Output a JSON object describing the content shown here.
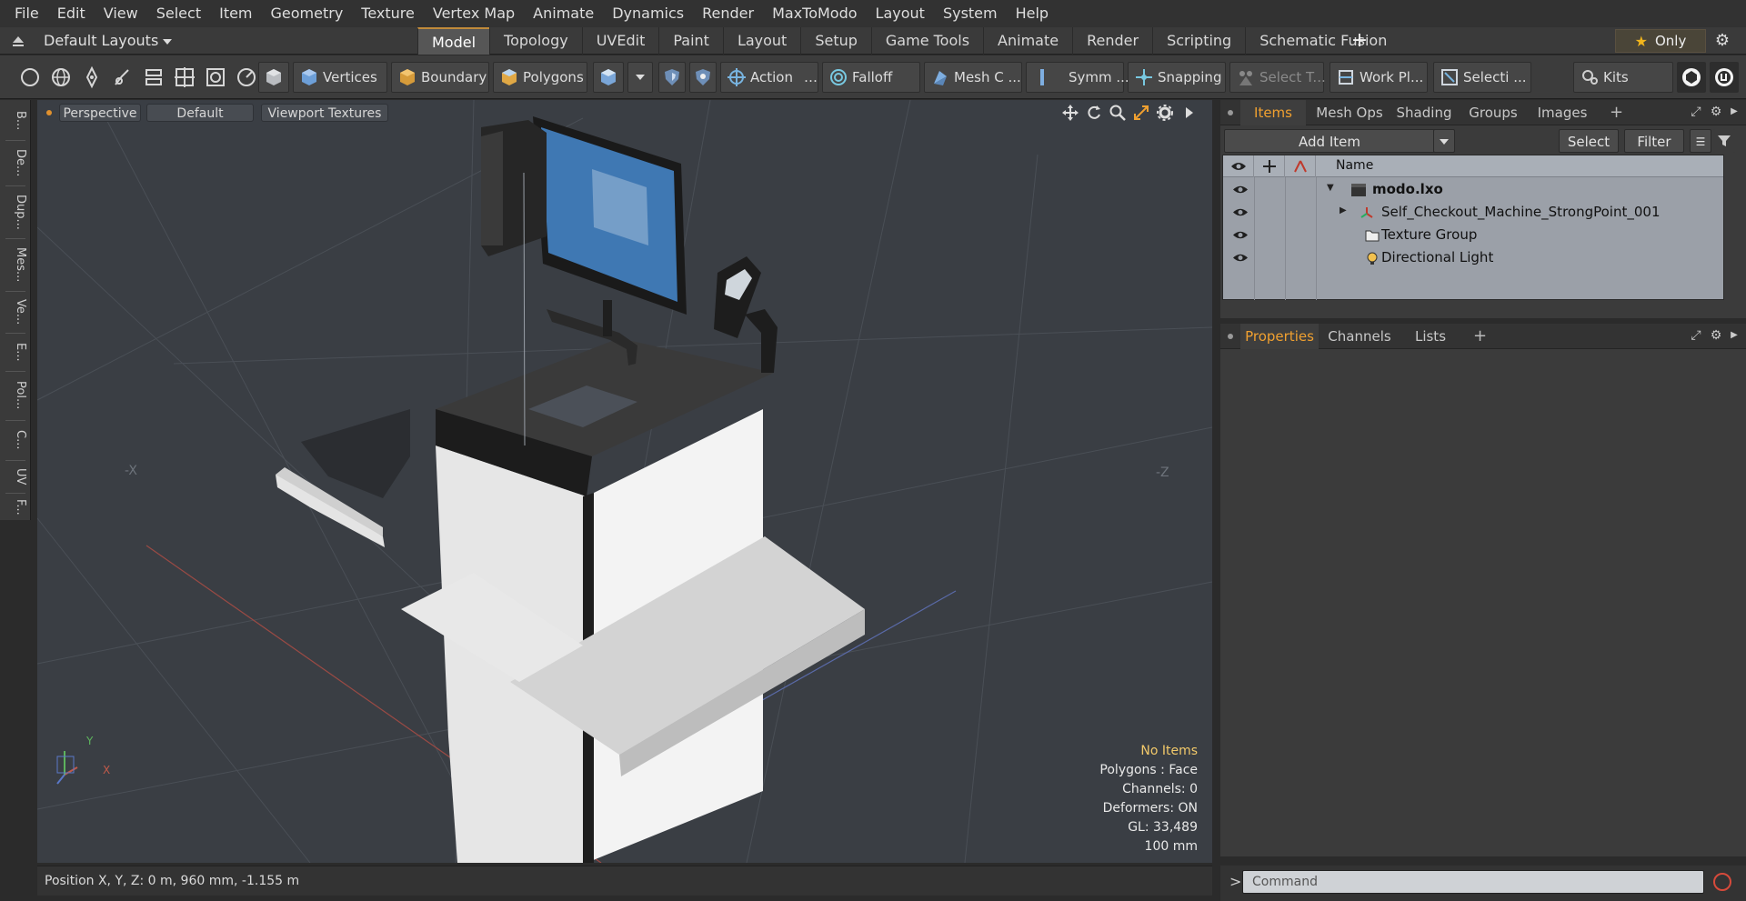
{
  "menu": [
    "File",
    "Edit",
    "View",
    "Select",
    "Item",
    "Geometry",
    "Texture",
    "Vertex Map",
    "Animate",
    "Dynamics",
    "Render",
    "MaxToModo",
    "Layout",
    "System",
    "Help"
  ],
  "layoutbar": {
    "layouts_label": "Default Layouts",
    "tabs": [
      "Model",
      "Topology",
      "UVEdit",
      "Paint",
      "Layout",
      "Setup",
      "Game Tools",
      "Animate",
      "Render",
      "Scripting",
      "Schematic Fusion"
    ],
    "active_tab": "Model",
    "add_label": "+",
    "only_label": "Only"
  },
  "toolbar": {
    "vertices": "Vertices",
    "boundary": "Boundary",
    "polygons": "Polygons",
    "action": "Action",
    "falloff": "Falloff",
    "mesh_c": "Mesh C ...",
    "symm": "Symm ...",
    "snapping": "Snapping",
    "select_t": "Select T...",
    "work_pl": "Work Pl...",
    "selecti": "Selecti ...",
    "kits": "Kits"
  },
  "left_tabs": [
    "B...",
    "De...",
    "Dup...",
    "Mes...",
    "Ve...",
    "E...",
    "Pol...",
    "C...",
    "UV",
    "F..."
  ],
  "viewport": {
    "view_mode": "Perspective",
    "shading": "Default",
    "textures": "Viewport Textures",
    "axis_x_neg": "-X",
    "axis_z_neg": "-Z",
    "gizmo_y": "Y",
    "gizmo_x": "X",
    "hud": {
      "selection": "No Items",
      "polygons": "Polygons : Face",
      "channels": "Channels: 0",
      "deformers": "Deformers: ON",
      "gl": "GL: 33,489",
      "scale": "100 mm"
    }
  },
  "status": {
    "position": "Position X, Y, Z:   0 m, 960 mm, -1.155 m"
  },
  "items_panel": {
    "tabs": [
      "Items",
      "Mesh Ops",
      "Shading",
      "Groups",
      "Images"
    ],
    "active_tab": "Items",
    "add_item": "Add Item",
    "select_btn": "Select",
    "filter_btn": "Filter",
    "name_col": "Name",
    "tree": [
      {
        "label": "modo.lxo",
        "bold": true
      },
      {
        "label": "Self_Checkout_Machine_StrongPoint_001"
      },
      {
        "label": "Texture Group"
      },
      {
        "label": "Directional Light"
      }
    ]
  },
  "props_panel": {
    "tabs": [
      "Properties",
      "Channels",
      "Lists"
    ],
    "active_tab": "Properties"
  },
  "command": {
    "placeholder": "Command",
    "prompt": ">"
  },
  "colors": {
    "accent_orange": "#f0a030",
    "hud_yellow": "#f2c96a",
    "viewport_bg": "#3a3e44",
    "tree_bg": "#9ba0a8"
  }
}
